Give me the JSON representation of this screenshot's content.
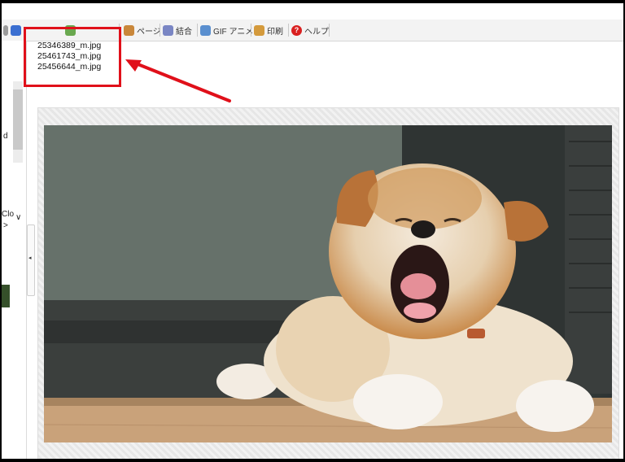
{
  "toolbar": {
    "items": [
      {
        "label": "ページ",
        "icon": "page-icon",
        "color": "#c9873a"
      },
      {
        "label": "結合",
        "icon": "merge-icon",
        "color": "#7a86c4"
      },
      {
        "label": "GIF アニメ",
        "icon": "gif-animation-icon",
        "color": "#5a8fcf"
      },
      {
        "label": "印刷",
        "icon": "print-icon",
        "color": "#d49a3c"
      },
      {
        "label": "ヘルプ",
        "icon": "help-icon",
        "color": "#d92020"
      }
    ]
  },
  "file_list": {
    "items": [
      "25346389_m.jpg",
      "25461743_m.jpg",
      "25456644_m.jpg"
    ]
  },
  "left_panel": {
    "fragment_d": "d",
    "fragment_clo": "Clo",
    "chevron_down": "∨",
    "chevron_right": ">",
    "collapse_arrow": "◂"
  },
  "help_glyph": "?",
  "colors": {
    "highlight": "#e0101a",
    "arrow": "#e0101a"
  }
}
